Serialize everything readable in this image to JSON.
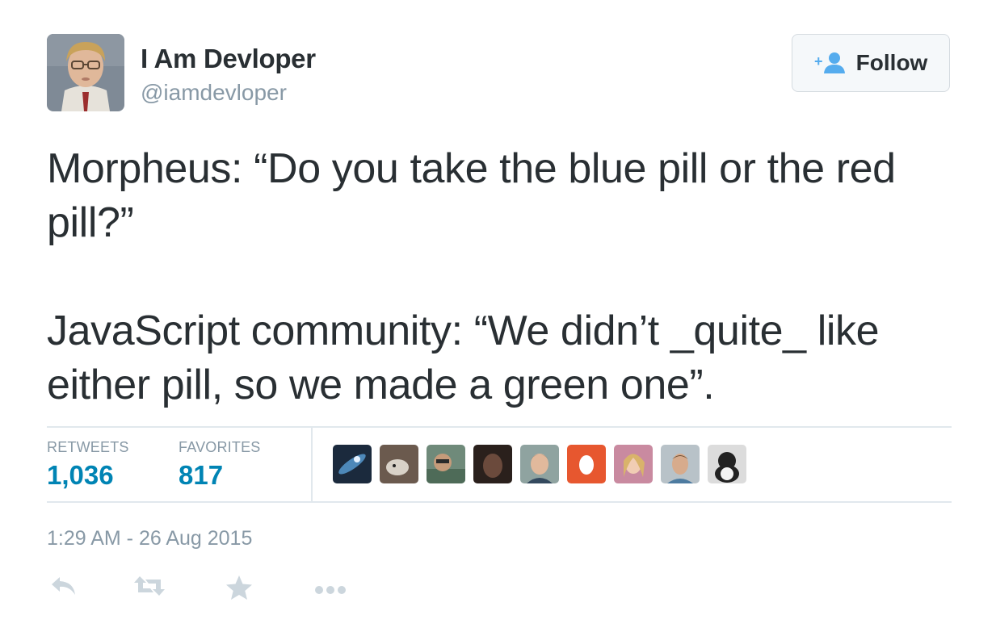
{
  "user": {
    "name": "I Am Devloper",
    "handle": "@iamdevloper"
  },
  "follow_button": {
    "label": "Follow",
    "icon": "person-plus-icon"
  },
  "tweet": {
    "text": "Morpheus: “Do you take the blue pill or the red pill?”\n\nJavaScript community: “We didn’t _quite_ like either pill, so we made a green one”."
  },
  "stats": {
    "retweets": {
      "label": "RETWEETS",
      "value": "1,036"
    },
    "favorites": {
      "label": "FAVORITES",
      "value": "817"
    }
  },
  "timestamp": "1:29 AM - 26 Aug 2015",
  "actions": [
    {
      "name": "reply",
      "icon": "reply-icon"
    },
    {
      "name": "retweet",
      "icon": "retweet-icon"
    },
    {
      "name": "favorite",
      "icon": "star-icon"
    },
    {
      "name": "more",
      "icon": "more-dots-icon"
    }
  ],
  "colors": {
    "link_blue": "#0084b4",
    "follow_icon": "#55acee",
    "muted": "#8899a6",
    "text": "#292f33",
    "divider": "#e1e8ed",
    "action_gray": "#ccd6dd"
  }
}
